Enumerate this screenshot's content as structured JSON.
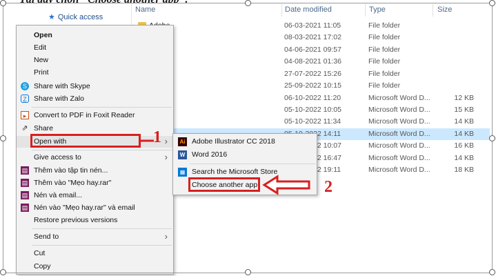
{
  "caption": "Tại đây chọn \"Choose another app\".",
  "explorer": {
    "quick_access": "Quick access",
    "columns": {
      "name": "Name",
      "date": "Date modified",
      "type": "Type",
      "size": "Size"
    },
    "rows": [
      {
        "name": "Adobe",
        "date": "06-03-2021 11:05",
        "type": "File folder",
        "size": ""
      },
      {
        "name": "",
        "date": "08-03-2021 17:02",
        "type": "File folder",
        "size": ""
      },
      {
        "name": "",
        "date": "04-06-2021 09:57",
        "type": "File folder",
        "size": ""
      },
      {
        "name": "",
        "date": "04-08-2021 01:36",
        "type": "File folder",
        "size": ""
      },
      {
        "name": "",
        "date": "27-07-2022 15:26",
        "type": "File folder",
        "size": ""
      },
      {
        "name": "",
        "date": "25-09-2022 10:15",
        "type": "File folder",
        "size": ""
      },
      {
        "name": "",
        "date": "06-10-2022 11:20",
        "type": "Microsoft Word D...",
        "size": "12 KB"
      },
      {
        "name": "",
        "date": "05-10-2022 10:05",
        "type": "Microsoft Word D...",
        "size": "15 KB"
      },
      {
        "name": "",
        "date": "05-10-2022 11:34",
        "type": "Microsoft Word D...",
        "size": "14 KB"
      },
      {
        "name": "",
        "date": "05-10-2022 14:11",
        "type": "Microsoft Word D...",
        "size": "14 KB"
      },
      {
        "name": "",
        "date": "05-10-2022 10:07",
        "type": "Microsoft Word D...",
        "size": "16 KB"
      },
      {
        "name": "",
        "date": "05-10-2022 16:47",
        "type": "Microsoft Word D...",
        "size": "14 KB"
      },
      {
        "name": "",
        "date": "05-10-2022 19:11",
        "type": "Microsoft Word D...",
        "size": "18 KB"
      }
    ]
  },
  "context_menu": {
    "items": {
      "open": "Open",
      "edit": "Edit",
      "new": "New",
      "print": "Print",
      "share_skype": "Share with Skype",
      "share_zalo": "Share with Zalo",
      "convert_pdf": "Convert to PDF in Foxit Reader",
      "share": "Share",
      "open_with": "Open with",
      "give_access": "Give access to",
      "add_archive": "Thêm vào tập tin nén...",
      "add_rar": "Thêm vào \"Mẹo hay.rar\"",
      "compress_email": "Nén và email...",
      "compress_rar_email": "Nén vào \"Mẹo hay.rar\" và email",
      "restore": "Restore previous versions",
      "send_to": "Send to",
      "cut": "Cut",
      "copy": "Copy"
    }
  },
  "submenu": {
    "illustrator": "Adobe Illustrator CC 2018",
    "word": "Word 2016",
    "store": "Search the Microsoft Store",
    "choose": "Choose another app"
  },
  "annotations": {
    "step1": "1",
    "step2": "2"
  },
  "colors": {
    "annotation_red": "#d81f1f",
    "selection_blue": "#cce8ff",
    "menu_bg": "#f2f2f2"
  }
}
